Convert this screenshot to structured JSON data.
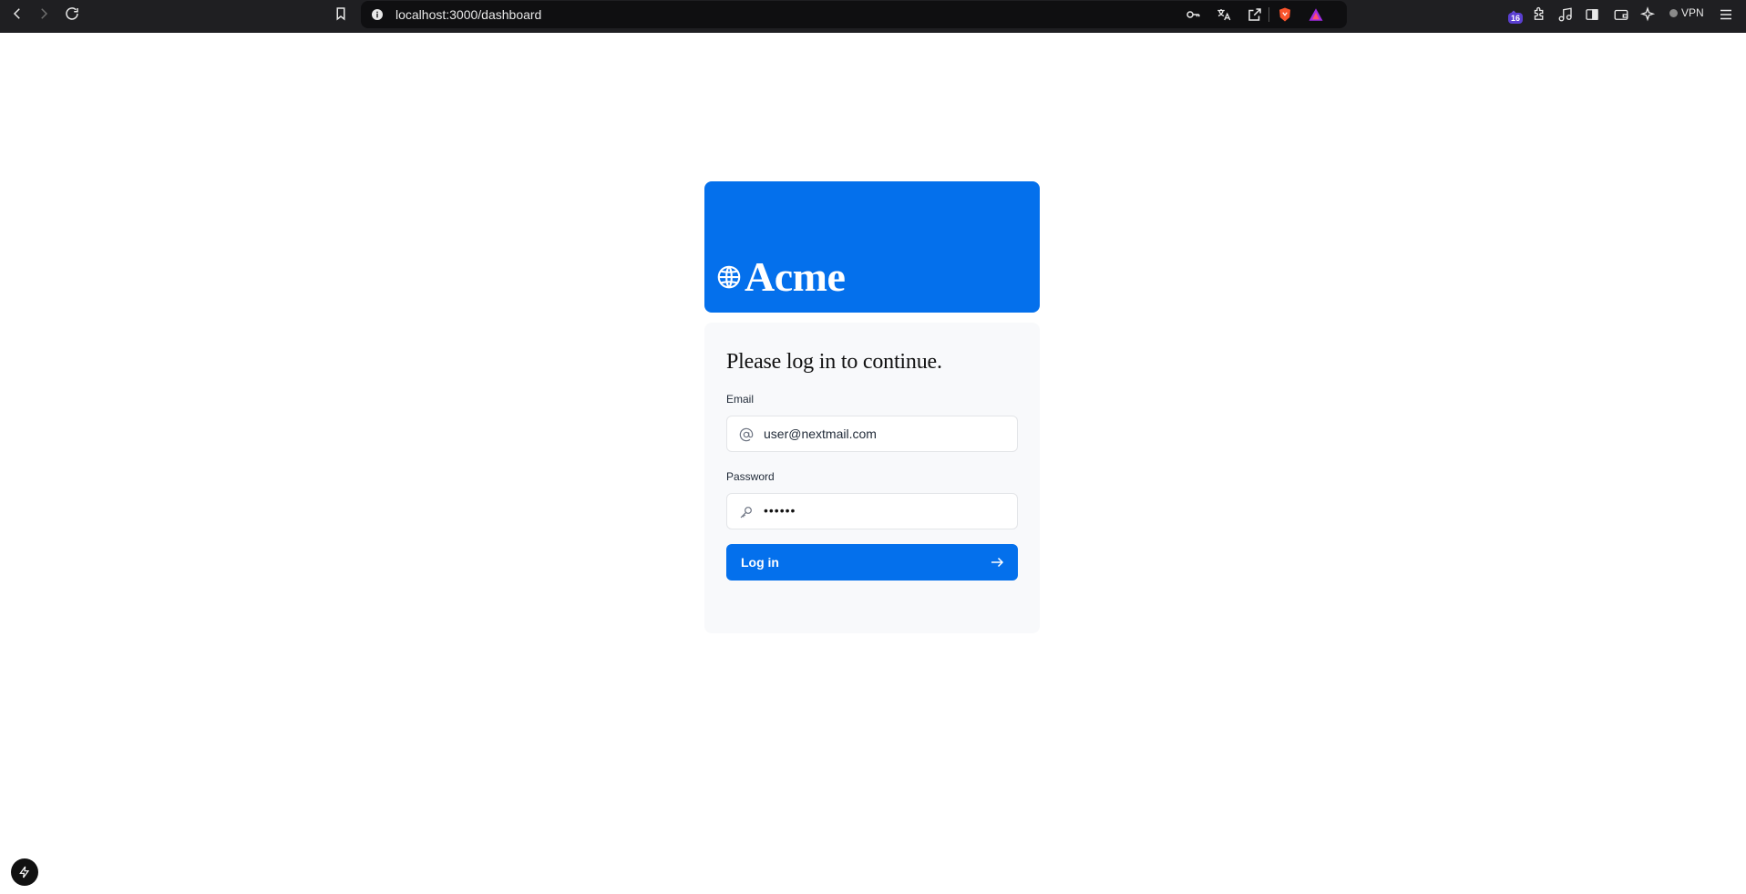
{
  "browser": {
    "url": "localhost:3000/dashboard",
    "extension_badge": "16",
    "vpn_label": "VPN"
  },
  "brand": {
    "name": "Acme",
    "logo_icon": "globe-icon",
    "color": "#0470ec"
  },
  "login": {
    "heading": "Please log in to continue.",
    "email_label": "Email",
    "email_value": "user@nextmail.com",
    "email_icon": "at-sign-icon",
    "password_label": "Password",
    "password_value": "••••••",
    "password_icon": "key-icon",
    "submit_label": "Log in",
    "submit_icon": "arrow-right-icon"
  }
}
